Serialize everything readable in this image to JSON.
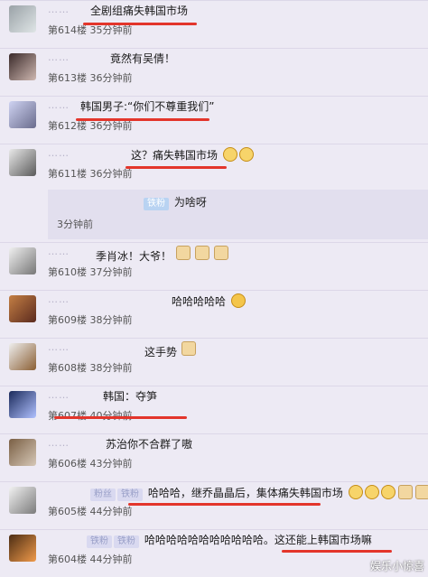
{
  "comments": [
    {
      "user": "……",
      "text": "全剧组痛失韩国市场",
      "floor": "第614楼",
      "time": "35分钟前"
    },
    {
      "user": "……",
      "text": "竟然有吴倩！",
      "floor": "第613楼",
      "time": "36分钟前"
    },
    {
      "user": "……",
      "text": "韩国男子:“你们不尊重我们”",
      "floor": "第612楼",
      "time": "36分钟前"
    },
    {
      "user": "……",
      "text": "这？痛失韩国市场",
      "floor": "第611楼",
      "time": "36分钟前"
    },
    {
      "reply_badge": "铁粉",
      "text": "为啥呀",
      "time": "3分钟前"
    },
    {
      "user": "……",
      "text": "季肖冰！大爷！",
      "floor": "第610楼",
      "time": "37分钟前"
    },
    {
      "user": "……",
      "text": "哈哈哈哈哈",
      "floor": "第609楼",
      "time": "38分钟前"
    },
    {
      "user": "……",
      "text": "这手势",
      "floor": "第608楼",
      "time": "38分钟前"
    },
    {
      "user": "……",
      "text": "韩国：夺笋",
      "floor": "第607楼",
      "time": "40分钟前"
    },
    {
      "user": "……",
      "text": "苏治你不合群了嗷",
      "floor": "第606楼",
      "time": "43分钟前"
    },
    {
      "badges": [
        "粉丝",
        "铁粉"
      ],
      "text": "哈哈哈，继乔晶晶后，集体痛失韩国市场",
      "floor": "第605楼",
      "time": "44分钟前"
    },
    {
      "badges": [
        "铁粉",
        "铁粉"
      ],
      "text": "哈哈哈哈哈哈哈哈哈哈哈。这还能上韩国市场嘛",
      "floor": "第604楼",
      "time": "44分钟前"
    }
  ],
  "watermark": "娱乐小惊喜",
  "colors": {
    "underline": "#e3352b",
    "badge": "#b9d3f2"
  }
}
